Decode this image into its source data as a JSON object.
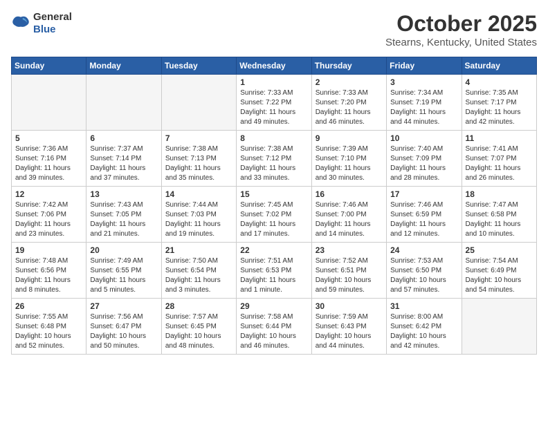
{
  "logo": {
    "general": "General",
    "blue": "Blue"
  },
  "header": {
    "month": "October 2025",
    "location": "Stearns, Kentucky, United States"
  },
  "weekdays": [
    "Sunday",
    "Monday",
    "Tuesday",
    "Wednesday",
    "Thursday",
    "Friday",
    "Saturday"
  ],
  "weeks": [
    [
      {
        "day": null
      },
      {
        "day": null
      },
      {
        "day": null
      },
      {
        "day": 1,
        "sunrise": "7:33 AM",
        "sunset": "7:22 PM",
        "daylight": "11 hours and 49 minutes."
      },
      {
        "day": 2,
        "sunrise": "7:33 AM",
        "sunset": "7:20 PM",
        "daylight": "11 hours and 46 minutes."
      },
      {
        "day": 3,
        "sunrise": "7:34 AM",
        "sunset": "7:19 PM",
        "daylight": "11 hours and 44 minutes."
      },
      {
        "day": 4,
        "sunrise": "7:35 AM",
        "sunset": "7:17 PM",
        "daylight": "11 hours and 42 minutes."
      }
    ],
    [
      {
        "day": 5,
        "sunrise": "7:36 AM",
        "sunset": "7:16 PM",
        "daylight": "11 hours and 39 minutes."
      },
      {
        "day": 6,
        "sunrise": "7:37 AM",
        "sunset": "7:14 PM",
        "daylight": "11 hours and 37 minutes."
      },
      {
        "day": 7,
        "sunrise": "7:38 AM",
        "sunset": "7:13 PM",
        "daylight": "11 hours and 35 minutes."
      },
      {
        "day": 8,
        "sunrise": "7:38 AM",
        "sunset": "7:12 PM",
        "daylight": "11 hours and 33 minutes."
      },
      {
        "day": 9,
        "sunrise": "7:39 AM",
        "sunset": "7:10 PM",
        "daylight": "11 hours and 30 minutes."
      },
      {
        "day": 10,
        "sunrise": "7:40 AM",
        "sunset": "7:09 PM",
        "daylight": "11 hours and 28 minutes."
      },
      {
        "day": 11,
        "sunrise": "7:41 AM",
        "sunset": "7:07 PM",
        "daylight": "11 hours and 26 minutes."
      }
    ],
    [
      {
        "day": 12,
        "sunrise": "7:42 AM",
        "sunset": "7:06 PM",
        "daylight": "11 hours and 23 minutes."
      },
      {
        "day": 13,
        "sunrise": "7:43 AM",
        "sunset": "7:05 PM",
        "daylight": "11 hours and 21 minutes."
      },
      {
        "day": 14,
        "sunrise": "7:44 AM",
        "sunset": "7:03 PM",
        "daylight": "11 hours and 19 minutes."
      },
      {
        "day": 15,
        "sunrise": "7:45 AM",
        "sunset": "7:02 PM",
        "daylight": "11 hours and 17 minutes."
      },
      {
        "day": 16,
        "sunrise": "7:46 AM",
        "sunset": "7:00 PM",
        "daylight": "11 hours and 14 minutes."
      },
      {
        "day": 17,
        "sunrise": "7:46 AM",
        "sunset": "6:59 PM",
        "daylight": "11 hours and 12 minutes."
      },
      {
        "day": 18,
        "sunrise": "7:47 AM",
        "sunset": "6:58 PM",
        "daylight": "11 hours and 10 minutes."
      }
    ],
    [
      {
        "day": 19,
        "sunrise": "7:48 AM",
        "sunset": "6:56 PM",
        "daylight": "11 hours and 8 minutes."
      },
      {
        "day": 20,
        "sunrise": "7:49 AM",
        "sunset": "6:55 PM",
        "daylight": "11 hours and 5 minutes."
      },
      {
        "day": 21,
        "sunrise": "7:50 AM",
        "sunset": "6:54 PM",
        "daylight": "11 hours and 3 minutes."
      },
      {
        "day": 22,
        "sunrise": "7:51 AM",
        "sunset": "6:53 PM",
        "daylight": "11 hours and 1 minute."
      },
      {
        "day": 23,
        "sunrise": "7:52 AM",
        "sunset": "6:51 PM",
        "daylight": "10 hours and 59 minutes."
      },
      {
        "day": 24,
        "sunrise": "7:53 AM",
        "sunset": "6:50 PM",
        "daylight": "10 hours and 57 minutes."
      },
      {
        "day": 25,
        "sunrise": "7:54 AM",
        "sunset": "6:49 PM",
        "daylight": "10 hours and 54 minutes."
      }
    ],
    [
      {
        "day": 26,
        "sunrise": "7:55 AM",
        "sunset": "6:48 PM",
        "daylight": "10 hours and 52 minutes."
      },
      {
        "day": 27,
        "sunrise": "7:56 AM",
        "sunset": "6:47 PM",
        "daylight": "10 hours and 50 minutes."
      },
      {
        "day": 28,
        "sunrise": "7:57 AM",
        "sunset": "6:45 PM",
        "daylight": "10 hours and 48 minutes."
      },
      {
        "day": 29,
        "sunrise": "7:58 AM",
        "sunset": "6:44 PM",
        "daylight": "10 hours and 46 minutes."
      },
      {
        "day": 30,
        "sunrise": "7:59 AM",
        "sunset": "6:43 PM",
        "daylight": "10 hours and 44 minutes."
      },
      {
        "day": 31,
        "sunrise": "8:00 AM",
        "sunset": "6:42 PM",
        "daylight": "10 hours and 42 minutes."
      },
      {
        "day": null
      }
    ]
  ],
  "labels": {
    "sunrise": "Sunrise:",
    "sunset": "Sunset:",
    "daylight": "Daylight:"
  }
}
